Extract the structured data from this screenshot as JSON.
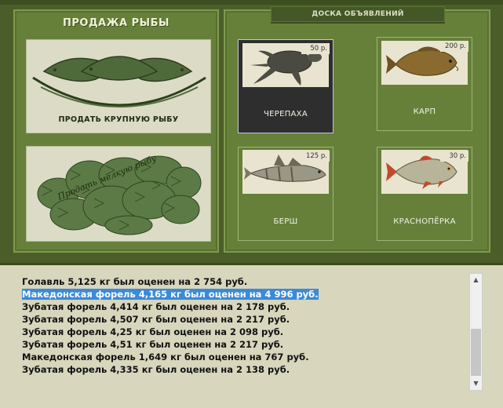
{
  "sell": {
    "title": "ПРОДАЖА РЫБЫ",
    "big_label": "ПРОДАТЬ КРУПНУЮ РЫБУ",
    "small_label": "Продать мелкую рыбу"
  },
  "board": {
    "title": "ДОСКА ОБЪЯВЛЕНИЙ",
    "cards": [
      {
        "name": "ЧЕРЕПАХА",
        "price": "50 р.",
        "icon": "turtle-icon",
        "selected": true
      },
      {
        "name": "КАРП",
        "price": "200 р.",
        "icon": "carp-icon"
      },
      {
        "name": "БЕРШ",
        "price": "125 р.",
        "icon": "zander-icon"
      },
      {
        "name": "КРАСНОПЁРКА",
        "price": "30 р.",
        "icon": "rudd-icon"
      }
    ]
  },
  "log": {
    "selected_index": 1,
    "lines": [
      "Голавль 5,125 кг был оценен на 2 754 руб.",
      "Македонская форель 4,165 кг был оценен на 4 996 руб.",
      "Зубатая форель 4,414 кг был оценен на 2 178 руб.",
      "Зубатая форель 4,507 кг был оценен на 2 217 руб.",
      "Зубатая форель 4,25 кг был оценен на 2 098 руб.",
      "Зубатая форель 4,51 кг был оценен на 2 217 руб.",
      "Македонская форель 1,649 кг был оценен на 767 руб.",
      "Зубатая форель 4,335 кг был оценен на 2 138 руб."
    ]
  },
  "scrollbar": {
    "up_icon": "▲",
    "down_icon": "▼"
  },
  "colors": {
    "panel": "#66803a",
    "background": "#4b5e2a",
    "highlight": "#3b8ad8",
    "log_bg": "#d8d6bc"
  }
}
